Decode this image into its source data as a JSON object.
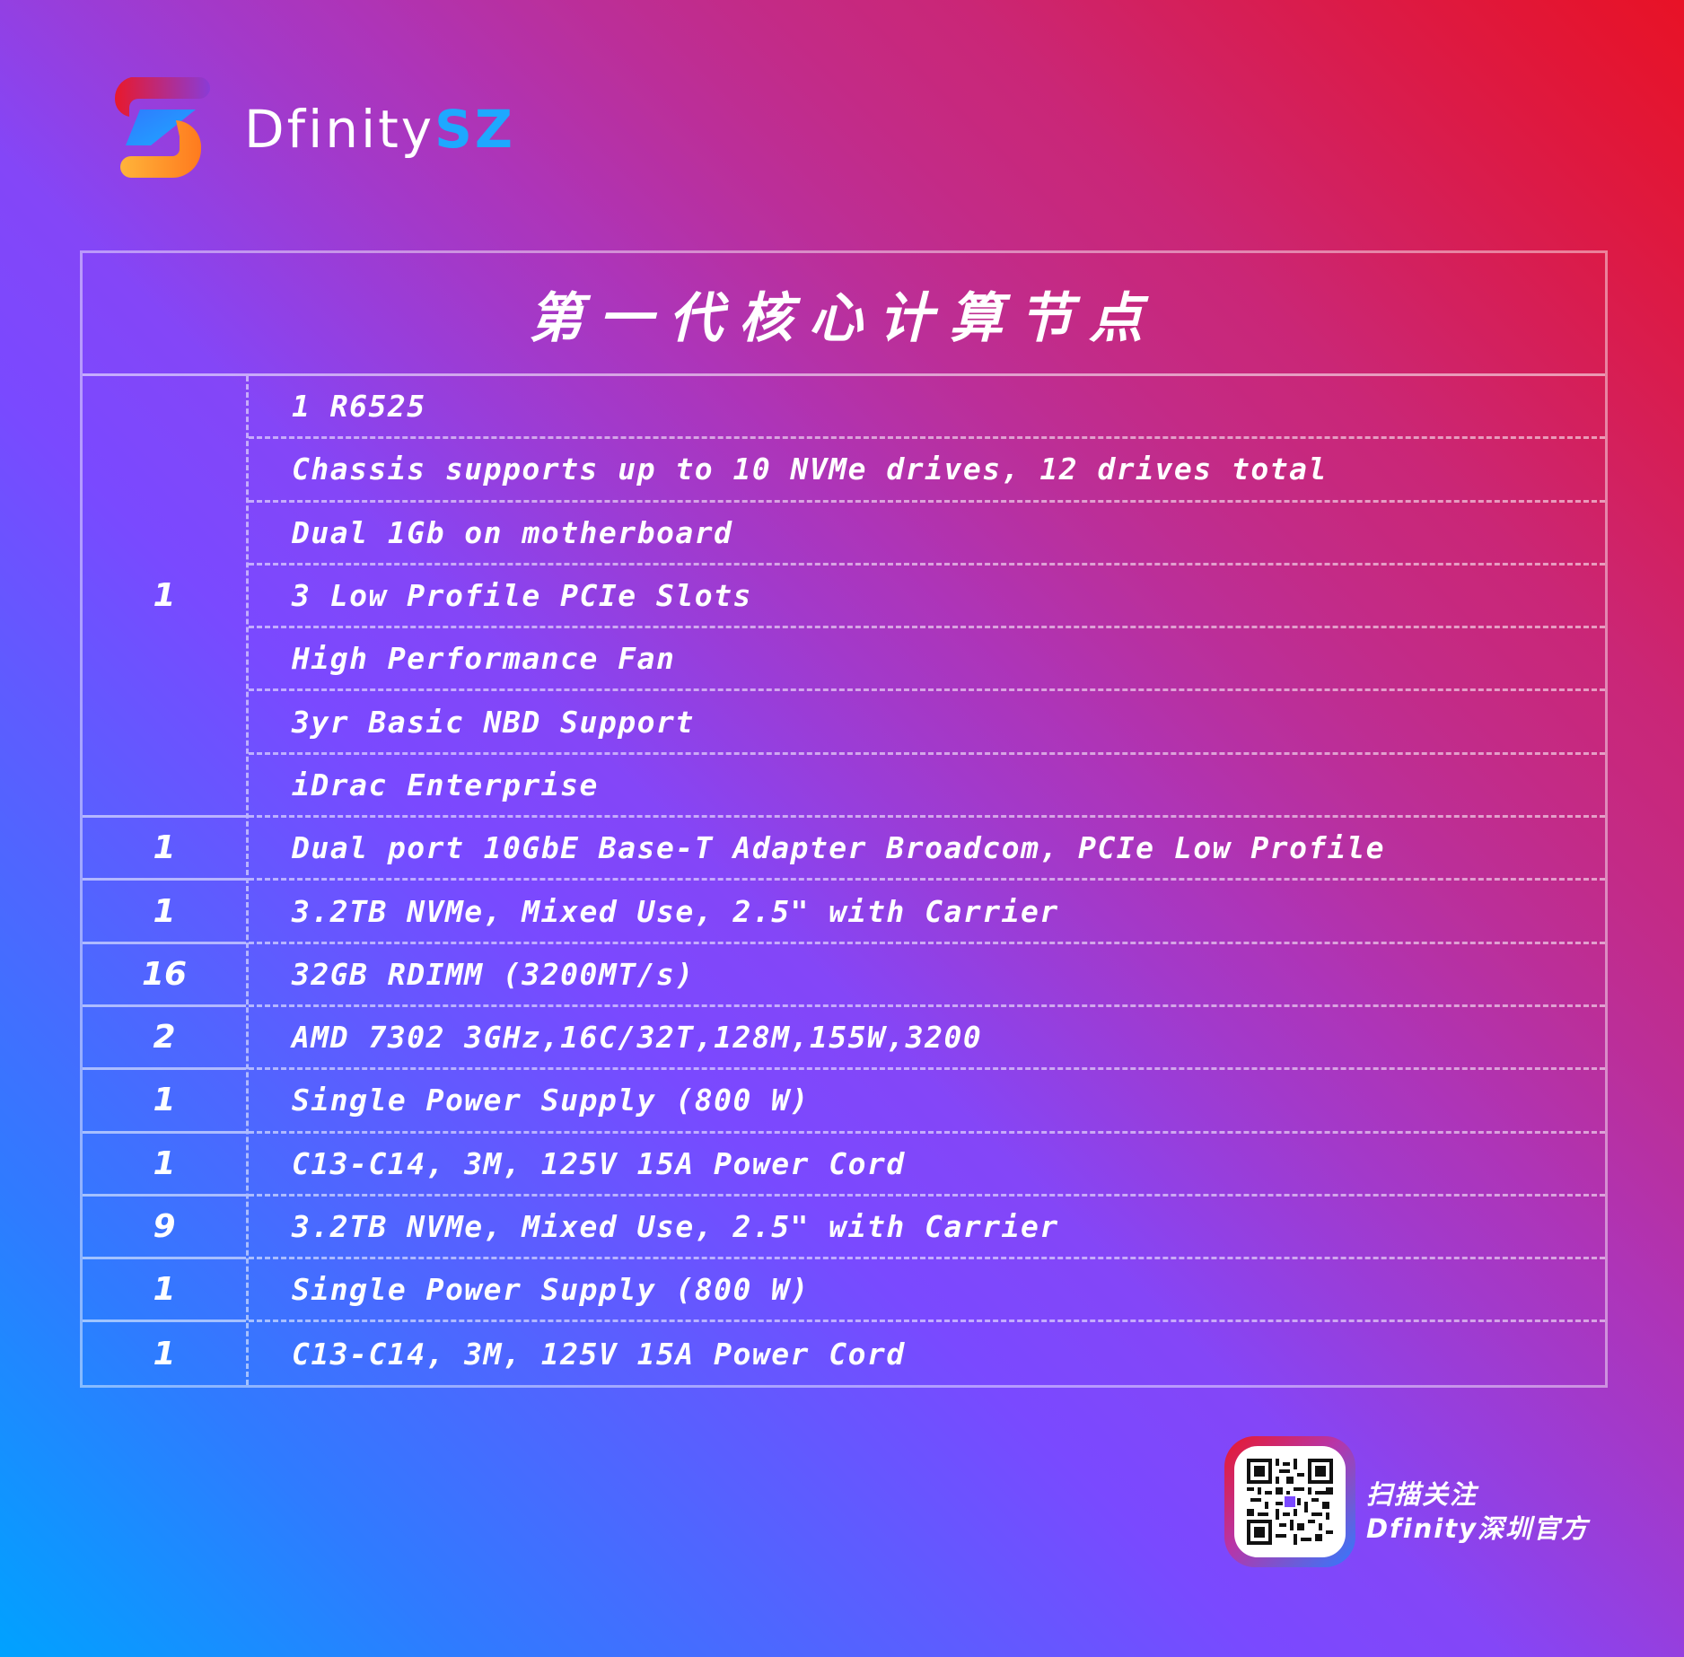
{
  "brand": {
    "name_prefix": "Dfinity",
    "name_suffix": "SZ"
  },
  "colors": {
    "accent_blue": "#1ea8ff",
    "accent_red": "#e8192c",
    "accent_orange": "#ff9a2e",
    "text": "#ffffff"
  },
  "table": {
    "title": "第一代核心计算节点",
    "groups": [
      {
        "qty": "1",
        "items": [
          "1 R6525",
          "Chassis supports up to 10 NVMe drives, 12 drives total",
          "Dual 1Gb on motherboard",
          "3 Low Profile PCIe Slots",
          "High Performance Fan",
          "3yr Basic NBD Support",
          "iDrac Enterprise"
        ]
      },
      {
        "qty": "1",
        "items": [
          "Dual port 10GbE Base-T Adapter Broadcom, PCIe Low Profile"
        ]
      },
      {
        "qty": "1",
        "items": [
          "3.2TB NVMe, Mixed Use, 2.5\" with Carrier"
        ]
      },
      {
        "qty": "16",
        "items": [
          "32GB RDIMM (3200MT/s)"
        ]
      },
      {
        "qty": "2",
        "items": [
          " AMD 7302 3GHz,16C/32T,128M,155W,3200"
        ]
      },
      {
        "qty": "1",
        "items": [
          "Single Power Supply (800 W)"
        ]
      },
      {
        "qty": "1",
        "items": [
          "C13-C14, 3M, 125V 15A Power Cord"
        ]
      },
      {
        "qty": "9",
        "items": [
          "3.2TB NVMe, Mixed Use, 2.5\" with Carrier"
        ]
      },
      {
        "qty": "1",
        "items": [
          "Single Power Supply (800 W)"
        ]
      },
      {
        "qty": "1",
        "items": [
          "C13-C14, 3M, 125V 15A Power Cord"
        ]
      }
    ]
  },
  "follow": {
    "line1": "扫描关注",
    "line2": "Dfinity深圳官方",
    "qr_icon": "qr-code-icon"
  }
}
